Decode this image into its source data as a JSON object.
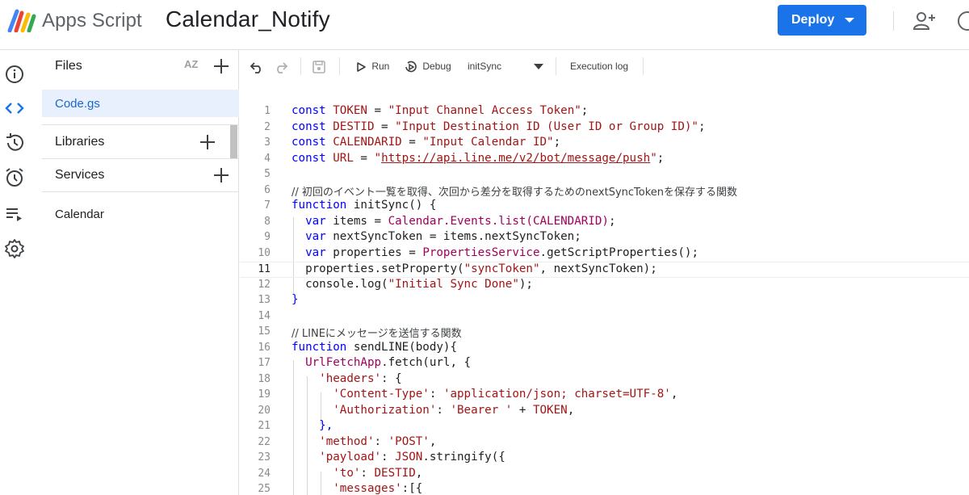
{
  "header": {
    "app_name": "Apps Script",
    "project_title": "Calendar_Notify",
    "deploy_label": "Deploy",
    "colors": {
      "deploy_bg": "#1a73e8"
    }
  },
  "rail": {
    "items": [
      {
        "name": "overview",
        "icon": "info-icon",
        "active": false
      },
      {
        "name": "editor",
        "icon": "code-icon",
        "active": true
      },
      {
        "name": "triggers",
        "icon": "history-icon",
        "active": false
      },
      {
        "name": "triggers",
        "icon": "alarm-clock-icon",
        "active": false
      },
      {
        "name": "executions",
        "icon": "playlist-icon",
        "active": false
      },
      {
        "name": "settings",
        "icon": "gear-icon",
        "active": false
      }
    ]
  },
  "panel": {
    "files_label": "Files",
    "sort_label": "AZ",
    "files": [
      {
        "name": "Code.gs",
        "selected": true
      }
    ],
    "libraries_label": "Libraries",
    "services_label": "Services",
    "services": [
      "Calendar"
    ]
  },
  "toolbar": {
    "run_label": "Run",
    "debug_label": "Debug",
    "function_select": "initSync",
    "execution_log_label": "Execution log"
  },
  "editor": {
    "current_line": 11,
    "lines": [
      {
        "n": "1"
      },
      {
        "n": "2"
      },
      {
        "n": "3"
      },
      {
        "n": "4"
      },
      {
        "n": "5"
      },
      {
        "n": "6"
      },
      {
        "n": "7"
      },
      {
        "n": "8"
      },
      {
        "n": "9"
      },
      {
        "n": "10"
      },
      {
        "n": "11"
      },
      {
        "n": "12"
      },
      {
        "n": "13"
      },
      {
        "n": "14"
      },
      {
        "n": "15"
      },
      {
        "n": "16"
      },
      {
        "n": "17"
      },
      {
        "n": "18"
      },
      {
        "n": "19"
      },
      {
        "n": "20"
      },
      {
        "n": "21"
      },
      {
        "n": "22"
      },
      {
        "n": "23"
      },
      {
        "n": "24"
      },
      {
        "n": "25"
      }
    ],
    "tokens": {
      "l1": [
        "const",
        "TOKEN",
        " = ",
        "\"Input Channel Access Token\"",
        ";"
      ],
      "l2": [
        "const",
        "DESTID",
        " = ",
        "\"Input Destination ID (User ID or Group ID)\"",
        ";"
      ],
      "l3": [
        "const",
        "CALENDARID",
        " = ",
        "\"Input Calendar ID\"",
        ";"
      ],
      "l4": [
        "const",
        "URL",
        " = ",
        "\"",
        "https://api.line.me/v2/bot/message/push",
        "\"",
        ";"
      ],
      "l6": "// 初回のイベント一覧を取得、次回から差分を取得するためのnextSyncTokenを保存する関数",
      "l7": [
        "function",
        " initSync() {"
      ],
      "l8": [
        "var",
        " items = ",
        "Calendar.Events.list(CALENDARID)",
        ";"
      ],
      "l9": [
        "var",
        " nextSyncToken = items.nextSyncToken;"
      ],
      "l10": [
        "var",
        " properties = ",
        "PropertiesService",
        ".getScriptProperties();"
      ],
      "l11": [
        "properties.setProperty(",
        "\"syncToken\"",
        ", nextSyncToken);"
      ],
      "l12": [
        "console.log(",
        "\"Initial Sync Done\"",
        ");"
      ],
      "l13": "}",
      "l15": "// LINEにメッセージを送信する関数",
      "l16": [
        "function",
        " sendLINE(body){"
      ],
      "l17": [
        "UrlFetchApp",
        ".fetch(url, {"
      ],
      "l18": [
        "'headers'",
        ": {"
      ],
      "l19": [
        "'Content-Type'",
        ": ",
        "'application/json; charset=UTF-8'",
        ","
      ],
      "l20": [
        "'Authorization'",
        ": ",
        "'Bearer '",
        " + ",
        "TOKEN",
        ","
      ],
      "l21": "},",
      "l22": [
        "'method'",
        ": ",
        "'POST'",
        ","
      ],
      "l23": [
        "'payload'",
        ": ",
        "JSON",
        ".stringify({"
      ],
      "l24": [
        "'to'",
        ": ",
        "DESTID",
        ","
      ],
      "l25": [
        "'messages'",
        ":[{"
      ]
    }
  }
}
